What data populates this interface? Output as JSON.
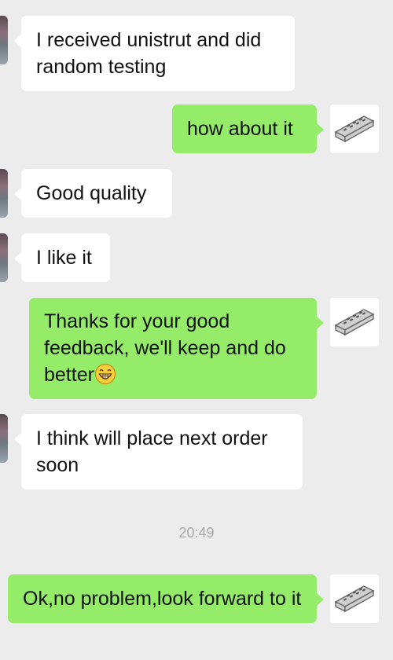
{
  "messages": [
    {
      "side": "in",
      "text": "I received unistrut and did random testing"
    },
    {
      "side": "out",
      "text": "how about it"
    },
    {
      "side": "in",
      "text": "Good quality"
    },
    {
      "side": "in",
      "text": "I like it"
    },
    {
      "side": "out",
      "text": "Thanks for your good feedback, we'll keep and do better",
      "emoji": "grinning-face-emoji"
    },
    {
      "side": "in",
      "text": "I think will place next order soon"
    },
    {
      "side": "out",
      "text": "Ok,no problem,look forward to it"
    }
  ],
  "timestamp": "20:49",
  "colors": {
    "background": "#ececec",
    "incoming_bubble": "#ffffff",
    "outgoing_bubble": "#95ec69",
    "timestamp_text": "#a8a8a8"
  },
  "icons": {
    "contact_avatar": "contact-avatar-photo",
    "self_avatar": "unistrut-product-avatar"
  }
}
